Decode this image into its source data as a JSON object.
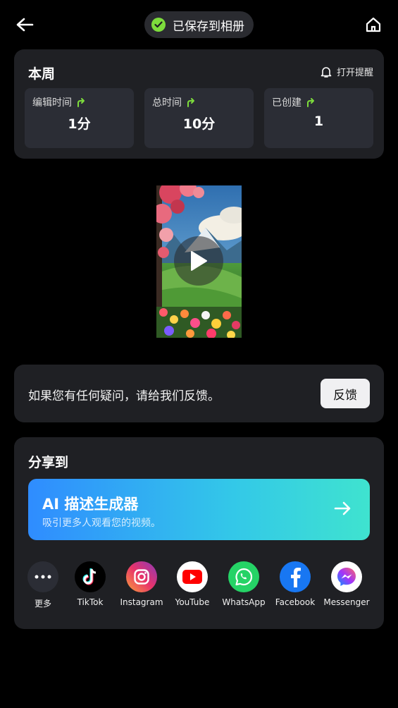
{
  "header": {
    "saved_text": "已保存到相册"
  },
  "week": {
    "title": "本周",
    "remind_label": "打开提醒",
    "stats": [
      {
        "label": "编辑时间",
        "value": "1分"
      },
      {
        "label": "总时间",
        "value": "10分"
      },
      {
        "label": "已创建",
        "value": "1"
      }
    ]
  },
  "feedback": {
    "text": "如果您有任何疑问，请给我们反馈。",
    "button": "反馈"
  },
  "share": {
    "title": "分享到",
    "ai_title": "AI 描述生成器",
    "ai_subtitle": "吸引更多人观看您的视频。",
    "apps": [
      {
        "label": "更多",
        "icon": "more-icon"
      },
      {
        "label": "TikTok",
        "icon": "tiktok-icon"
      },
      {
        "label": "Instagram",
        "icon": "instagram-icon"
      },
      {
        "label": "YouTube",
        "icon": "youtube-icon"
      },
      {
        "label": "WhatsApp",
        "icon": "whatsapp-icon"
      },
      {
        "label": "Facebook",
        "icon": "facebook-icon"
      },
      {
        "label": "Messenger",
        "icon": "messenger-icon"
      }
    ]
  },
  "colors": {
    "background": "#000000",
    "card": "#1f2024",
    "stat_box": "#2b2d35",
    "accent_green": "#7ddc3c",
    "ai_gradient_start": "#2f8cff",
    "ai_gradient_end": "#3fe3cf"
  }
}
